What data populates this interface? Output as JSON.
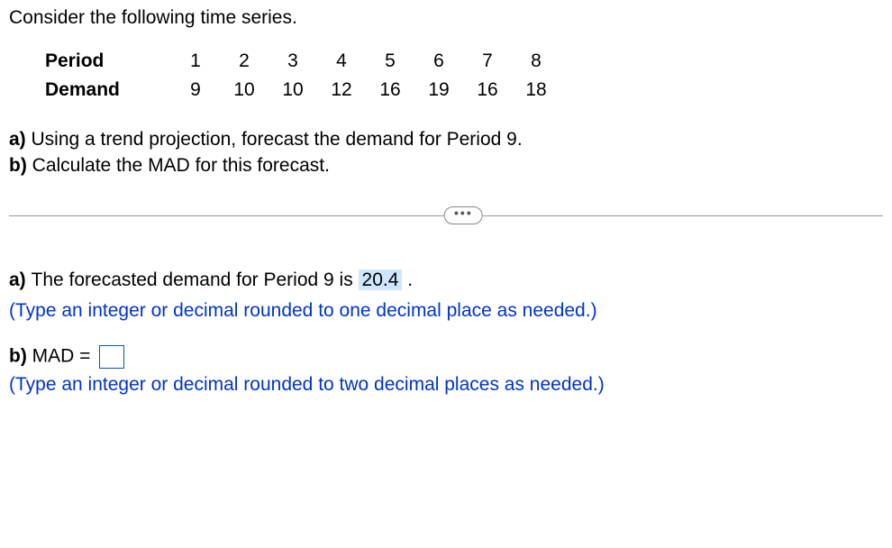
{
  "intro": "Consider the following time series.",
  "table": {
    "row1_label": "Period",
    "row2_label": "Demand",
    "periods": [
      "1",
      "2",
      "3",
      "4",
      "5",
      "6",
      "7",
      "8"
    ],
    "demands": [
      "9",
      "10",
      "10",
      "12",
      "16",
      "19",
      "16",
      "18"
    ]
  },
  "q_a_prefix": "a) ",
  "q_a_text": "Using a trend projection, forecast the demand for Period 9.",
  "q_b_prefix": "b) ",
  "q_b_text": "Calculate the MAD for this forecast.",
  "ans_a_prefix": "a) ",
  "ans_a_text1": "The forecasted demand for Period 9 is ",
  "ans_a_value": "20.4",
  "ans_a_text2": " .",
  "instruct_a": "(Type an integer or decimal rounded to one decimal place as needed.)",
  "ans_b_prefix": "b) ",
  "ans_b_text": "MAD = ",
  "instruct_b": "(Type an integer or decimal rounded to two decimal places as needed.)"
}
